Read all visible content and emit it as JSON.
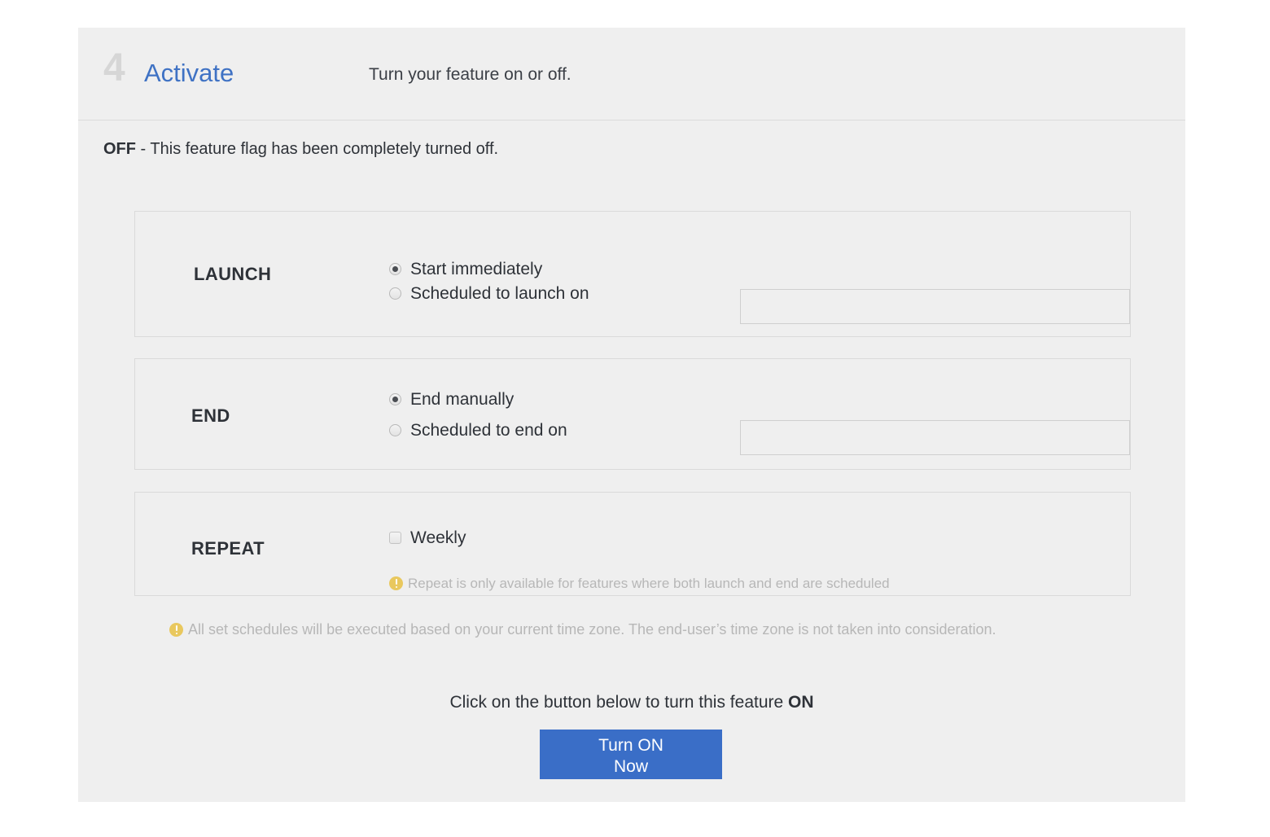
{
  "header": {
    "step_number": "4",
    "title": "Activate",
    "subtitle": "Turn your feature on or off."
  },
  "status": {
    "state": "OFF",
    "message": " - This feature flag has been completely turned off."
  },
  "sections": {
    "launch": {
      "label": "LAUNCH",
      "options": [
        {
          "label": "Start immediately",
          "checked": true
        },
        {
          "label": "Scheduled to launch on",
          "checked": false
        }
      ],
      "date_input": {
        "value": "",
        "placeholder": ""
      }
    },
    "end": {
      "label": "END",
      "options": [
        {
          "label": "End manually",
          "checked": true
        },
        {
          "label": "Scheduled to end on",
          "checked": false
        }
      ],
      "date_input": {
        "value": "",
        "placeholder": ""
      }
    },
    "repeat": {
      "label": "REPEAT",
      "options": [
        {
          "label": "Weekly",
          "checked": false
        }
      ],
      "hint": "Repeat is only available for features where both launch and end are scheduled"
    }
  },
  "timezone_note": "All set schedules will be executed based on your current time zone. The end-user’s time zone is not taken into consideration.",
  "cta": {
    "prompt_prefix": "Click on the button below to turn this feature ",
    "prompt_emphasis": "ON",
    "button_line1": "Turn ON",
    "button_line2": "Now"
  },
  "colors": {
    "accent_blue": "#3f72c4",
    "button_blue": "#3a6ec7",
    "panel_bg": "#efefef",
    "warning_yellow": "#e9c85e",
    "muted_text": "#b7b7b7"
  },
  "icons": {
    "warning": "warning-icon"
  }
}
